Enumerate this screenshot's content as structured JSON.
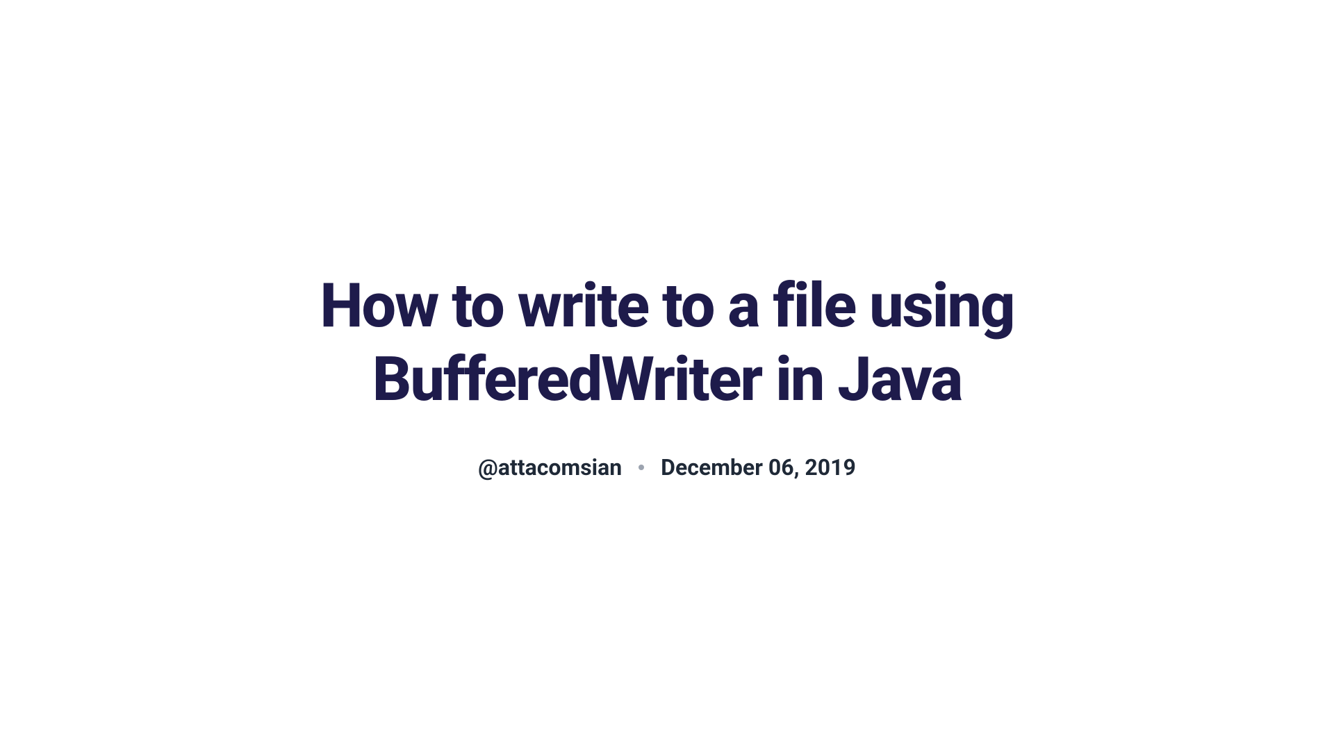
{
  "article": {
    "title": "How to write to a file using BufferedWriter in Java",
    "author_handle": "@attacomsian",
    "publish_date": "December 06, 2019"
  }
}
